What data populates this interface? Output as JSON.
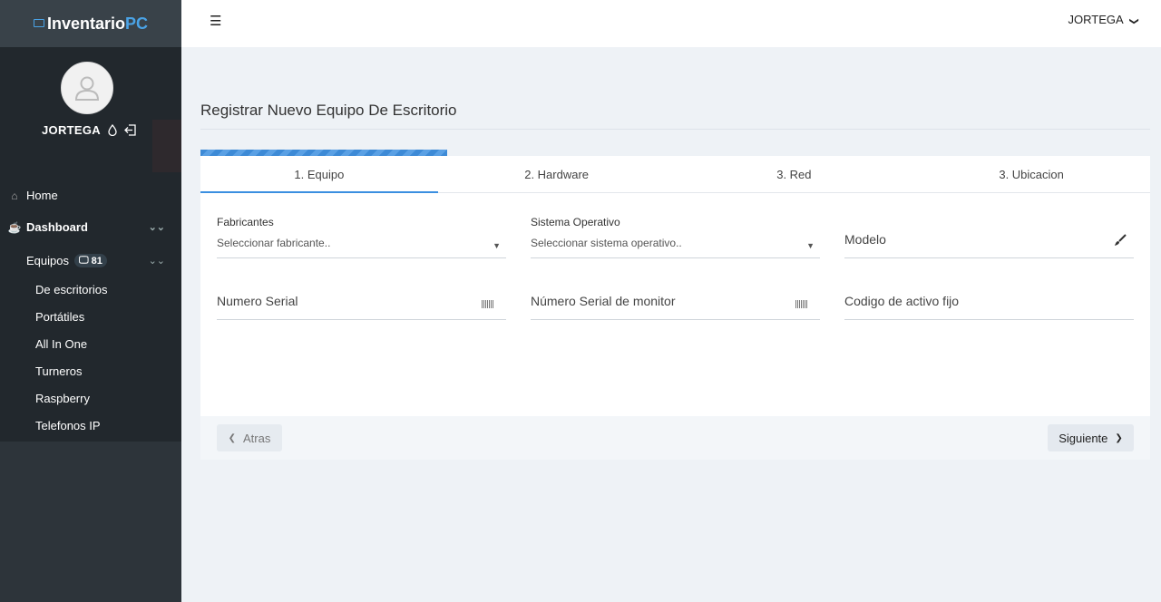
{
  "brand": {
    "name_main": "Inventario",
    "name_accent": "PC"
  },
  "header": {
    "username": "JORTEGA"
  },
  "profile": {
    "username": "JORTEGA"
  },
  "sidebar": {
    "home": "Home",
    "dashboard": "Dashboard",
    "equipos": {
      "label": "Equipos",
      "count": "81"
    },
    "sub_items": [
      "De escritorios",
      "Portátiles",
      "All In One",
      "Turneros",
      "Raspberry",
      "Telefonos IP"
    ]
  },
  "page": {
    "title": "Registrar Nuevo Equipo De Escritorio"
  },
  "wizard": {
    "progress_fraction": 0.26,
    "tabs": [
      "1. Equipo",
      "2. Hardware",
      "3. Red",
      "3. Ubicacion"
    ],
    "active_tab": 0
  },
  "form": {
    "fabricantes": {
      "label": "Fabricantes",
      "placeholder": "Seleccionar fabricante.."
    },
    "sistema_operativo": {
      "label": "Sistema Operativo",
      "placeholder": "Seleccionar sistema operativo.."
    },
    "modelo": {
      "placeholder": "Modelo"
    },
    "numero_serial": {
      "placeholder": "Numero Serial"
    },
    "serial_monitor": {
      "placeholder": "Número Serial de monitor"
    },
    "activo_fijo": {
      "placeholder": "Codigo de activo fijo"
    }
  },
  "buttons": {
    "back": "Atras",
    "next": "Siguiente"
  },
  "colors": {
    "accent": "#3b8fe0",
    "sidebar": "#2d343a",
    "background": "#eef2f6"
  }
}
